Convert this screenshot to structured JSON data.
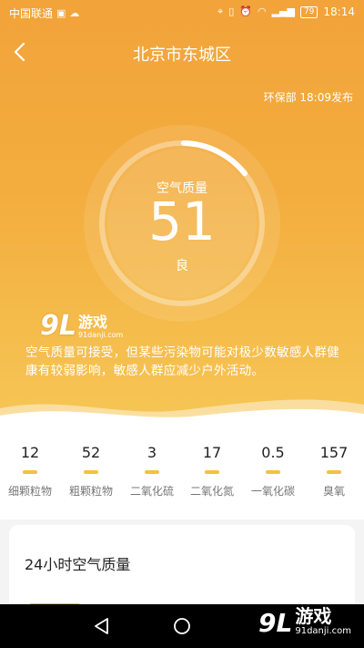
{
  "status_bar": {
    "carrier": "中国联通",
    "battery": "79",
    "time": "18:14"
  },
  "header": {
    "title": "北京市东城区",
    "publish_info": "环保部 18:09发布"
  },
  "aqi": {
    "label": "空气质量",
    "value": "51",
    "level": "良",
    "ring_fraction": 0.14
  },
  "description": "空气质量可接受，但某些污染物可能对极少数敏感人群健康有较弱影响，敏感人群应减少户外活动。",
  "watermark": {
    "number": "9L",
    "name": "游戏",
    "site": "91danji.com"
  },
  "pollutants": [
    {
      "value": "12",
      "name": "细颗粒物"
    },
    {
      "value": "52",
      "name": "粗颗粒物"
    },
    {
      "value": "3",
      "name": "二氧化硫"
    },
    {
      "value": "17",
      "name": "二氧化氮"
    },
    {
      "value": "0.5",
      "name": "一氧化碳"
    },
    {
      "value": "157",
      "name": "臭氧"
    }
  ],
  "card": {
    "title": "24小时空气质量"
  },
  "brand": {
    "number": "9L",
    "name": "游戏",
    "site": "91danji.com"
  },
  "colors": {
    "accent": "#f4c13a",
    "hero_top": "#f2a33a",
    "hero_bottom": "#f6c655"
  }
}
